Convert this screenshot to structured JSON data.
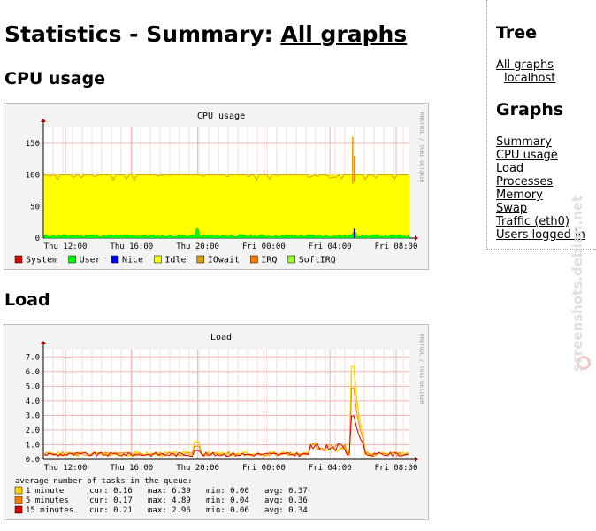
{
  "page": {
    "title_prefix": "Statistics - Summary:",
    "title_link": "All graphs"
  },
  "sections": {
    "cpu": "CPU usage",
    "load": "Load"
  },
  "sidebar": {
    "tree_heading": "Tree",
    "tree_items": [
      "All graphs",
      "localhost"
    ],
    "graphs_heading": "Graphs",
    "graph_items": [
      "Summary",
      "CPU usage",
      "Load",
      "Processes",
      "Memory",
      "Swap",
      "Traffic (eth0)",
      "Users logged in"
    ]
  },
  "watermark": "screenshots.debian.net",
  "colors": {
    "idle": "#ffff00",
    "user": "#00ff00",
    "nice": "#0000ff",
    "iowait": "#e0a000",
    "system": "#e00000",
    "irq": "#ff7f00",
    "softirq": "#99ff33",
    "grid_major": "#f2b4b4",
    "grid_minor": "#f2dede",
    "one_min": "#ffd700",
    "five_min": "#ff8000",
    "fifteen_min": "#e00000"
  },
  "chart_data": [
    {
      "type": "area",
      "title": "CPU usage",
      "side_label": "RRDTOOL / TOBI OETIKER",
      "x_ticks": [
        "Thu 12:00",
        "Thu 16:00",
        "Thu 20:00",
        "Fri 00:00",
        "Fri 04:00",
        "Fri 08:00"
      ],
      "y_ticks": [
        0,
        50,
        100,
        150
      ],
      "ylim": [
        0,
        175
      ],
      "legend": [
        {
          "name": "System",
          "color": "#e00000"
        },
        {
          "name": "User",
          "color": "#00ff00"
        },
        {
          "name": "Nice",
          "color": "#0000ff"
        },
        {
          "name": "Idle",
          "color": "#ffff00"
        },
        {
          "name": "IOwait",
          "color": "#e0a000"
        },
        {
          "name": "IRQ",
          "color": "#ff7f00"
        },
        {
          "name": "SoftIRQ",
          "color": "#99ff33"
        }
      ],
      "series": [
        {
          "name": "Idle",
          "stacked_total": 100
        },
        {
          "name": "User",
          "baseline": 3,
          "spikes": [
            [
              0.42,
              15
            ],
            [
              0.85,
              10
            ]
          ]
        },
        {
          "name": "IOwait",
          "peaks": [
            [
              0.845,
              160
            ],
            [
              0.85,
              130
            ]
          ]
        },
        {
          "name": "Nice",
          "peaks": [
            [
              0.85,
              15
            ]
          ]
        }
      ]
    },
    {
      "type": "line",
      "title": "Load",
      "side_label": "RRDTOOL / TOBI OETIKER",
      "x_ticks": [
        "Thu 12:00",
        "Thu 16:00",
        "Thu 20:00",
        "Fri 00:00",
        "Fri 04:00",
        "Fri 08:00"
      ],
      "y_ticks": [
        "0.0",
        "1.0",
        "2.0",
        "3.0",
        "4.0",
        "5.0",
        "6.0",
        "7.0"
      ],
      "ylim": [
        0,
        7.5
      ],
      "legend_header": "average number of tasks in the queue:",
      "legend": [
        {
          "name": "1 minute",
          "color": "#ffd700",
          "cur": "0.16",
          "max": "6.39",
          "min": "0.00",
          "avg": "0.37"
        },
        {
          "name": "5 minutes",
          "color": "#ff8000",
          "cur": "0.17",
          "max": "4.89",
          "min": "0.04",
          "avg": "0.36"
        },
        {
          "name": "15 minutes",
          "color": "#e00000",
          "cur": "0.21",
          "max": "2.96",
          "min": "0.06",
          "avg": "0.34"
        }
      ],
      "series": [
        {
          "name": "1 minute",
          "peak": 6.39,
          "avg": 0.37
        },
        {
          "name": "5 minutes",
          "peak": 4.89,
          "avg": 0.36
        },
        {
          "name": "15 minutes",
          "peak": 2.96,
          "avg": 0.34
        }
      ]
    }
  ]
}
